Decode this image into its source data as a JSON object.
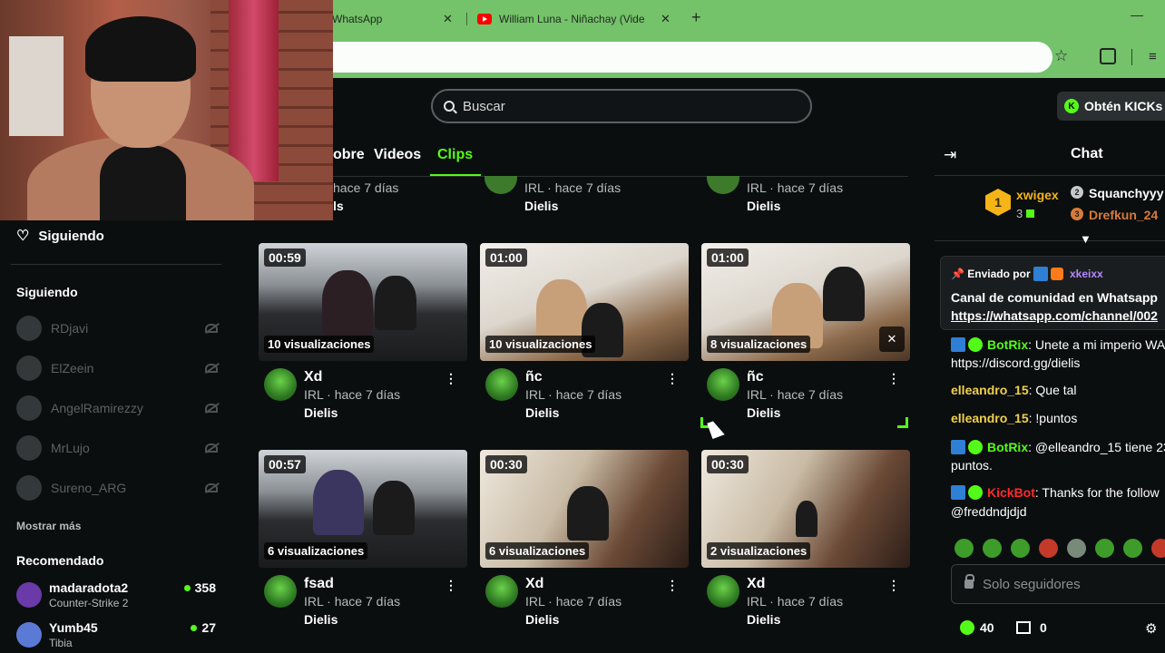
{
  "browser": {
    "tabs": [
      {
        "title": "WhatsApp"
      },
      {
        "title": "William Luna - Niñachay (Vide"
      }
    ],
    "new_tab": "+",
    "close": "✕",
    "minimize": "—"
  },
  "header": {
    "search_placeholder": "Buscar",
    "get_kicks": "Obtén KICKs"
  },
  "channel_tabs": {
    "about": "obre",
    "videos": "Videos",
    "clips": "Clips"
  },
  "sidebar": {
    "following_button": "Siguiendo",
    "following_heading": "Siguiendo",
    "following": [
      {
        "name": "RDjavi"
      },
      {
        "name": "ElZeein"
      },
      {
        "name": "AngelRamirezzy"
      },
      {
        "name": "MrLujo"
      },
      {
        "name": "Sureno_ARG"
      }
    ],
    "show_more": "Mostrar más",
    "recommended_heading": "Recomendado",
    "recommended": [
      {
        "name": "madaradota2",
        "game": "Counter-Strike 2",
        "viewers": "358"
      },
      {
        "name": "Yumb45",
        "game": "Tibia",
        "viewers": "27"
      }
    ]
  },
  "partial_row": [
    {
      "meta": "hace 7 días",
      "author": "ls"
    },
    {
      "meta": "IRL · hace 7 días",
      "author": "Dielis"
    },
    {
      "meta": "IRL · hace 7 días",
      "author": "Dielis"
    }
  ],
  "clips": [
    {
      "duration": "00:59",
      "views": "10 visualizaciones",
      "title": "Xd",
      "meta": "IRL · hace 7 días",
      "author": "Dielis",
      "scene": "car"
    },
    {
      "duration": "01:00",
      "views": "10 visualizaciones",
      "title": "ñc",
      "meta": "IRL · hace 7 días",
      "author": "Dielis",
      "scene": "room"
    },
    {
      "duration": "01:00",
      "views": "8 visualizaciones",
      "title": "ñc",
      "meta": "IRL · hace 7 días",
      "author": "Dielis",
      "scene": "room"
    },
    {
      "duration": "00:57",
      "views": "6 visualizaciones",
      "title": "fsad",
      "meta": "IRL · hace 7 días",
      "author": "Dielis",
      "scene": "car"
    },
    {
      "duration": "00:30",
      "views": "6 visualizaciones",
      "title": "Xd",
      "meta": "IRL · hace 7 días",
      "author": "Dielis",
      "scene": "hall"
    },
    {
      "duration": "00:30",
      "views": "2 visualizaciones",
      "title": "Xd",
      "meta": "IRL · hace 7 días",
      "author": "Dielis",
      "scene": "hall"
    }
  ],
  "chat": {
    "title": "Chat",
    "podium": {
      "first": {
        "rank": "1",
        "name": "xwigex",
        "count": "3"
      },
      "second": {
        "rank": "2",
        "name": "Squanchyyy"
      },
      "third": {
        "rank": "3",
        "name": "Drefkun_24"
      }
    },
    "pinned": {
      "sent_by": "Enviado por",
      "user": "xkeixx",
      "message": "Canal de comunidad en Whatsapp",
      "link": "https://whatsapp.com/channel/002"
    },
    "messages": [
      {
        "user": "BotRix",
        "text": ": Unete a mi imperio WA",
        "link": "https://discord.gg/dielis"
      },
      {
        "user": "elleandro_15",
        "text": ": Que tal"
      },
      {
        "user": "elleandro_15",
        "text": ": !puntos"
      },
      {
        "user": "BotRix",
        "text": ": @elleandro_15 tiene 23",
        "text2": "puntos."
      },
      {
        "user": "KickBot",
        "text": ": Thanks for the follow",
        "text2": "@freddndjdjd"
      }
    ],
    "input_placeholder": "Solo seguidores",
    "points": "40",
    "store": "0"
  },
  "colors": {
    "accent": "#53fc18",
    "browser_green": "#74c26a",
    "background": "#0b0e0f"
  }
}
